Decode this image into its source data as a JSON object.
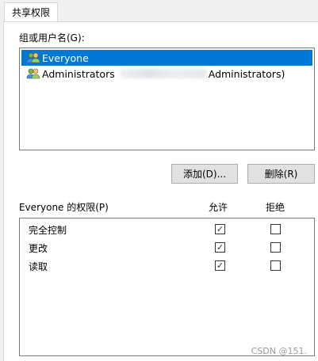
{
  "tab": {
    "label": "共享权限"
  },
  "group_users": {
    "label": "组或用户名(G):",
    "items": [
      {
        "name": "Everyone",
        "selected": true,
        "icon": "user-group-icon"
      },
      {
        "name_prefix": "Administrators",
        "name_suffix": "Administrators)",
        "selected": false,
        "icon": "user-group-icon"
      }
    ]
  },
  "buttons": {
    "add_label": "添加(D)...",
    "remove_label": "删除(R)"
  },
  "permissions": {
    "header": "Everyone 的权限(P)",
    "allow_header": "允许",
    "deny_header": "拒绝",
    "rows": [
      {
        "name": "完全控制",
        "allow": true,
        "deny": false
      },
      {
        "name": "更改",
        "allow": true,
        "deny": false
      },
      {
        "name": "读取",
        "allow": true,
        "deny": false
      }
    ]
  },
  "watermark": "CSDN @151.",
  "colors": {
    "selection": "#0078d7",
    "button_bg": "#e1e1e1",
    "panel_bg": "#ffffff",
    "window_bg": "#f0f0f0"
  }
}
